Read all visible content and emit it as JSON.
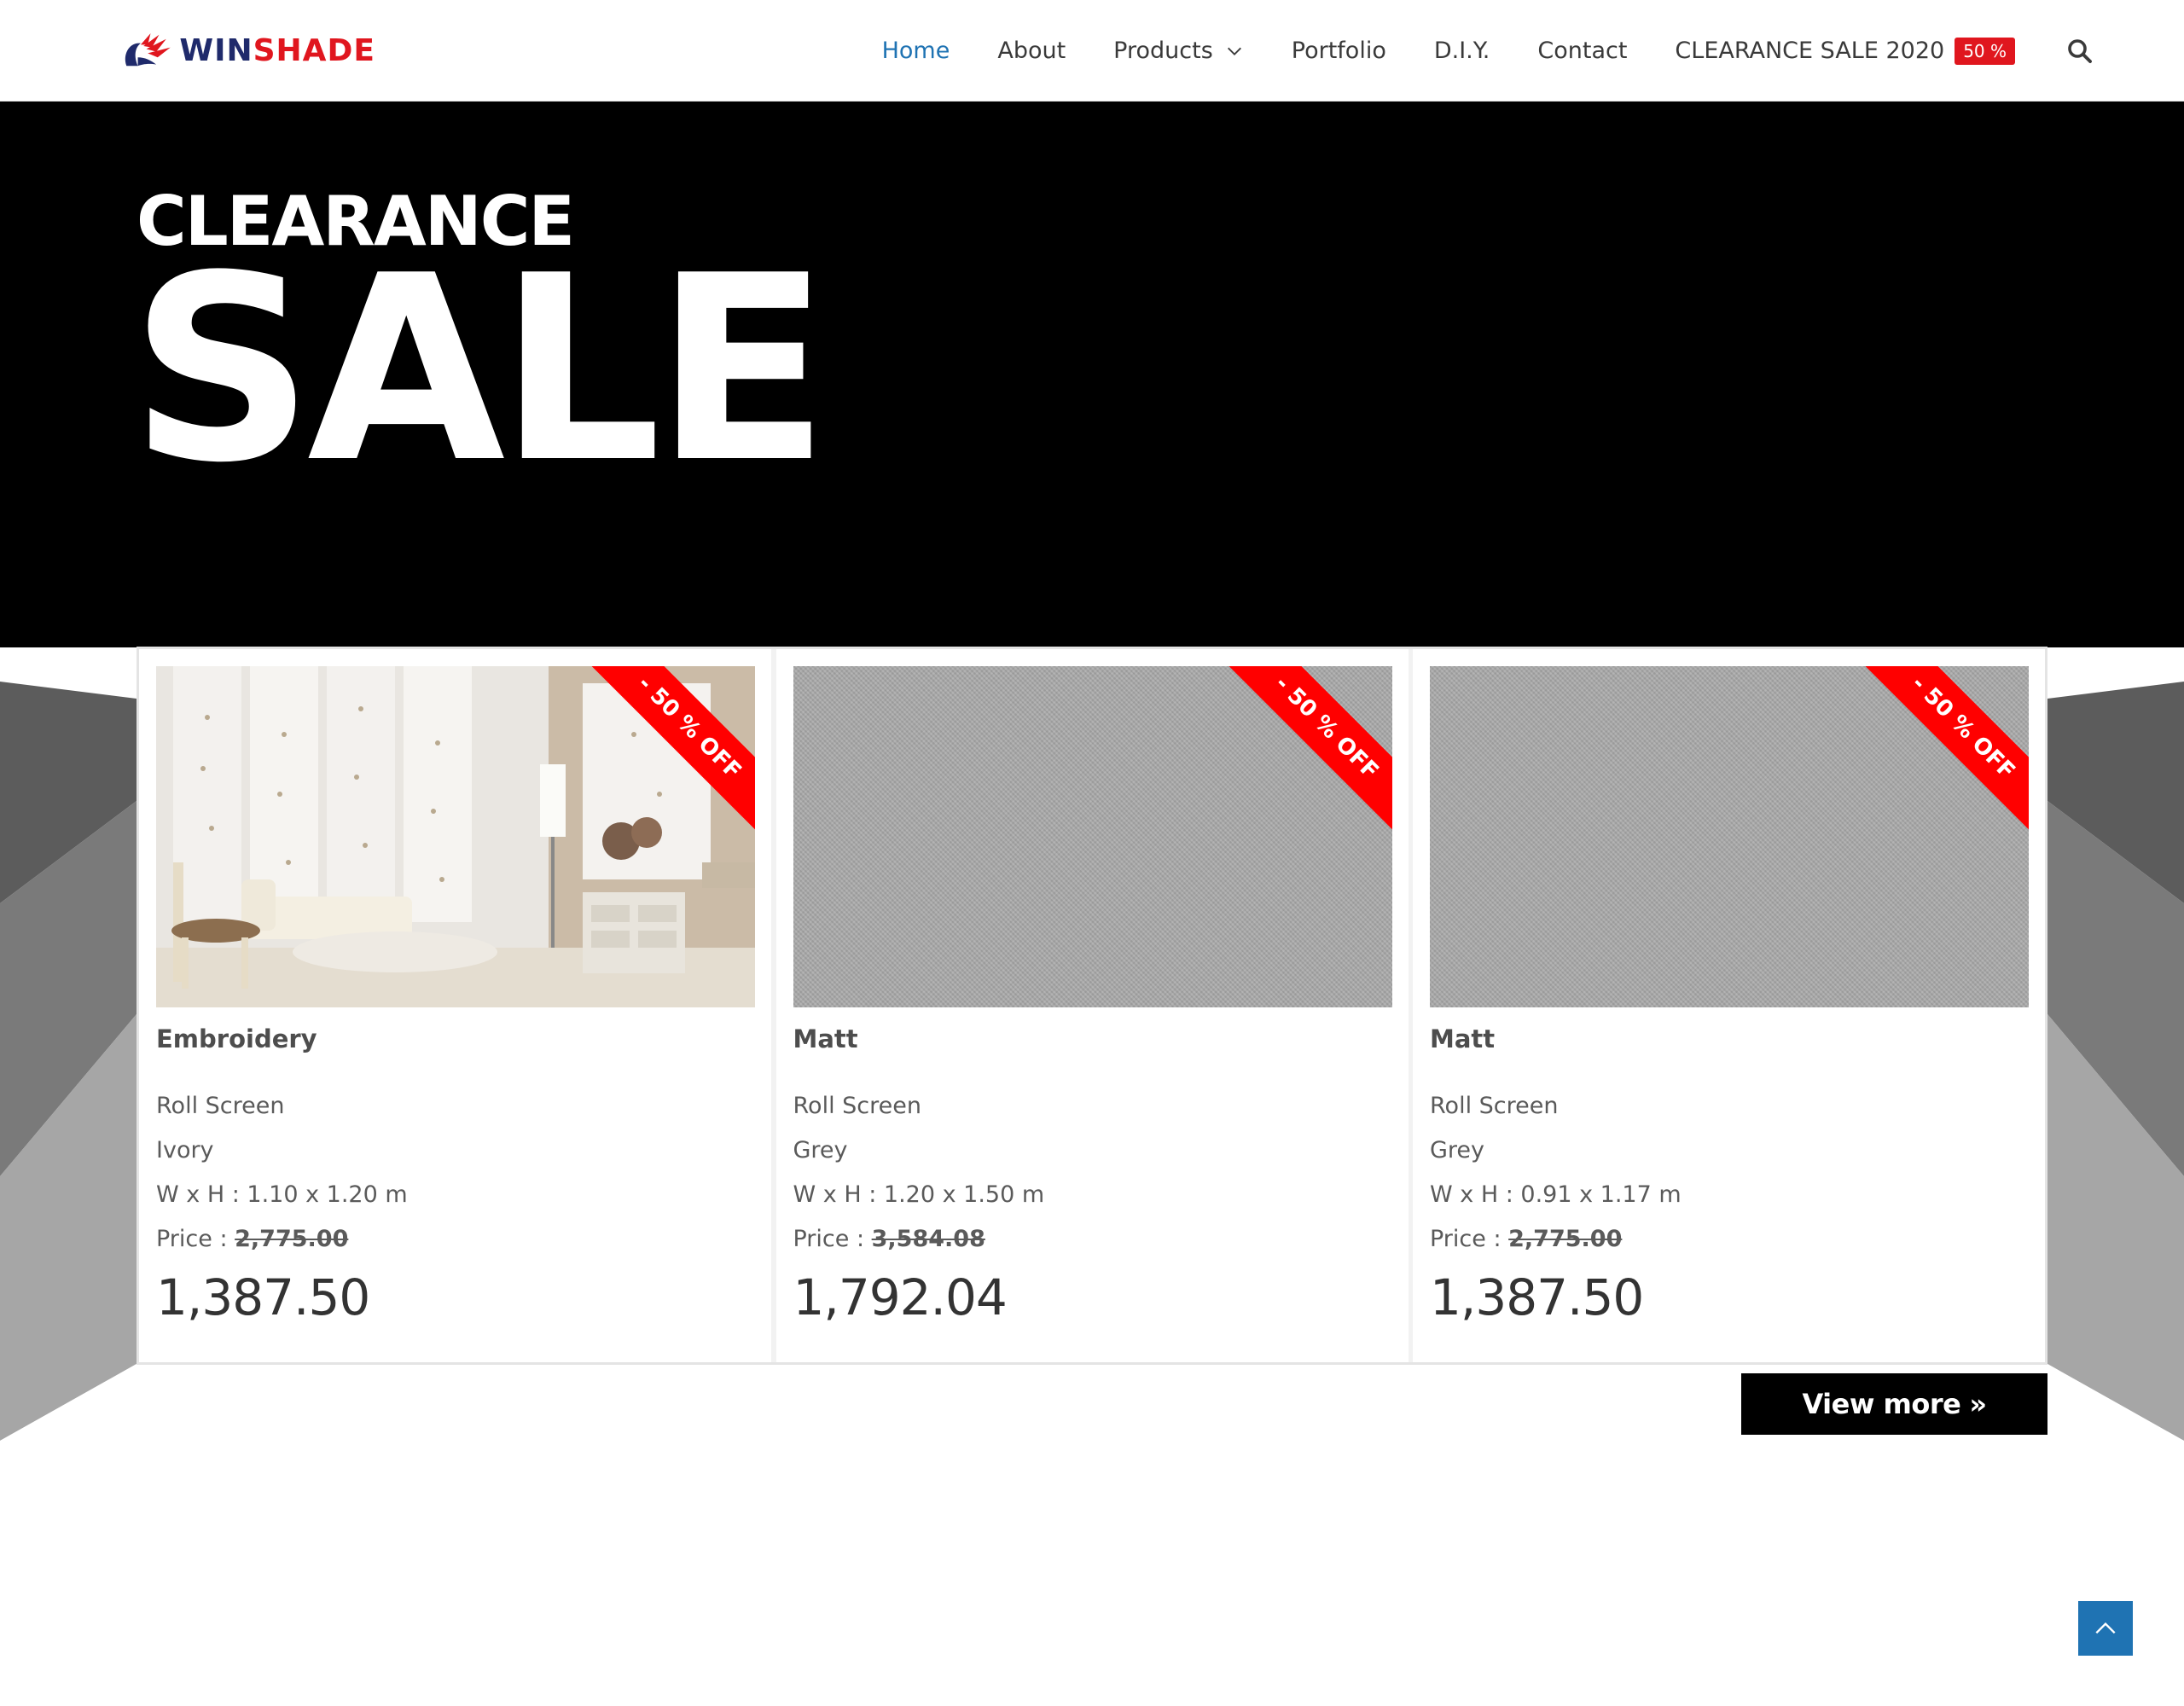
{
  "brand": {
    "logo_part1": "WIN",
    "logo_part2": "SHADE"
  },
  "nav": {
    "items": [
      {
        "label": "Home",
        "active": true
      },
      {
        "label": "About",
        "active": false
      },
      {
        "label": "Products",
        "active": false,
        "has_dropdown": true
      },
      {
        "label": "Portfolio",
        "active": false
      },
      {
        "label": "D.I.Y.",
        "active": false
      },
      {
        "label": "Contact",
        "active": false
      },
      {
        "label": "CLEARANCE SALE 2020",
        "active": false,
        "badge": "50 %"
      }
    ],
    "search_icon": "search-icon"
  },
  "hero": {
    "line1": "CLEARANCE",
    "line2": "SALE"
  },
  "products": [
    {
      "title": "Embroidery",
      "type": "Roll Screen",
      "color": "Ivory",
      "size": "W x H : 1.10 x 1.20 m",
      "price_label": "Price : ",
      "old_price": "2,775.00",
      "price": "1,387.50",
      "ribbon": "- 50 % OFF",
      "image": "room-interior-photo"
    },
    {
      "title": "Matt",
      "type": "Roll Screen",
      "color": "Grey",
      "size": "W x H : 1.20 x 1.50 m",
      "price_label": "Price : ",
      "old_price": "3,584.08",
      "price": "1,792.04",
      "ribbon": "- 50 % OFF",
      "image": "grey-fabric-swatch"
    },
    {
      "title": "Matt",
      "type": "Roll Screen",
      "color": "Grey",
      "size": "W x H : 0.91 x  1.17 m",
      "price_label": "Price : ",
      "old_price": "2,775.00",
      "price": "1,387.50",
      "ribbon": "- 50 % OFF",
      "image": "grey-fabric-swatch"
    }
  ],
  "view_more": {
    "label": "View more",
    "arrows": "»"
  },
  "colors": {
    "accent_blue": "#1f73b3",
    "brand_red": "#e0161e",
    "brand_navy": "#1f2a6b",
    "ribbon_red": "#ff0000",
    "hero_bg": "#000000"
  }
}
